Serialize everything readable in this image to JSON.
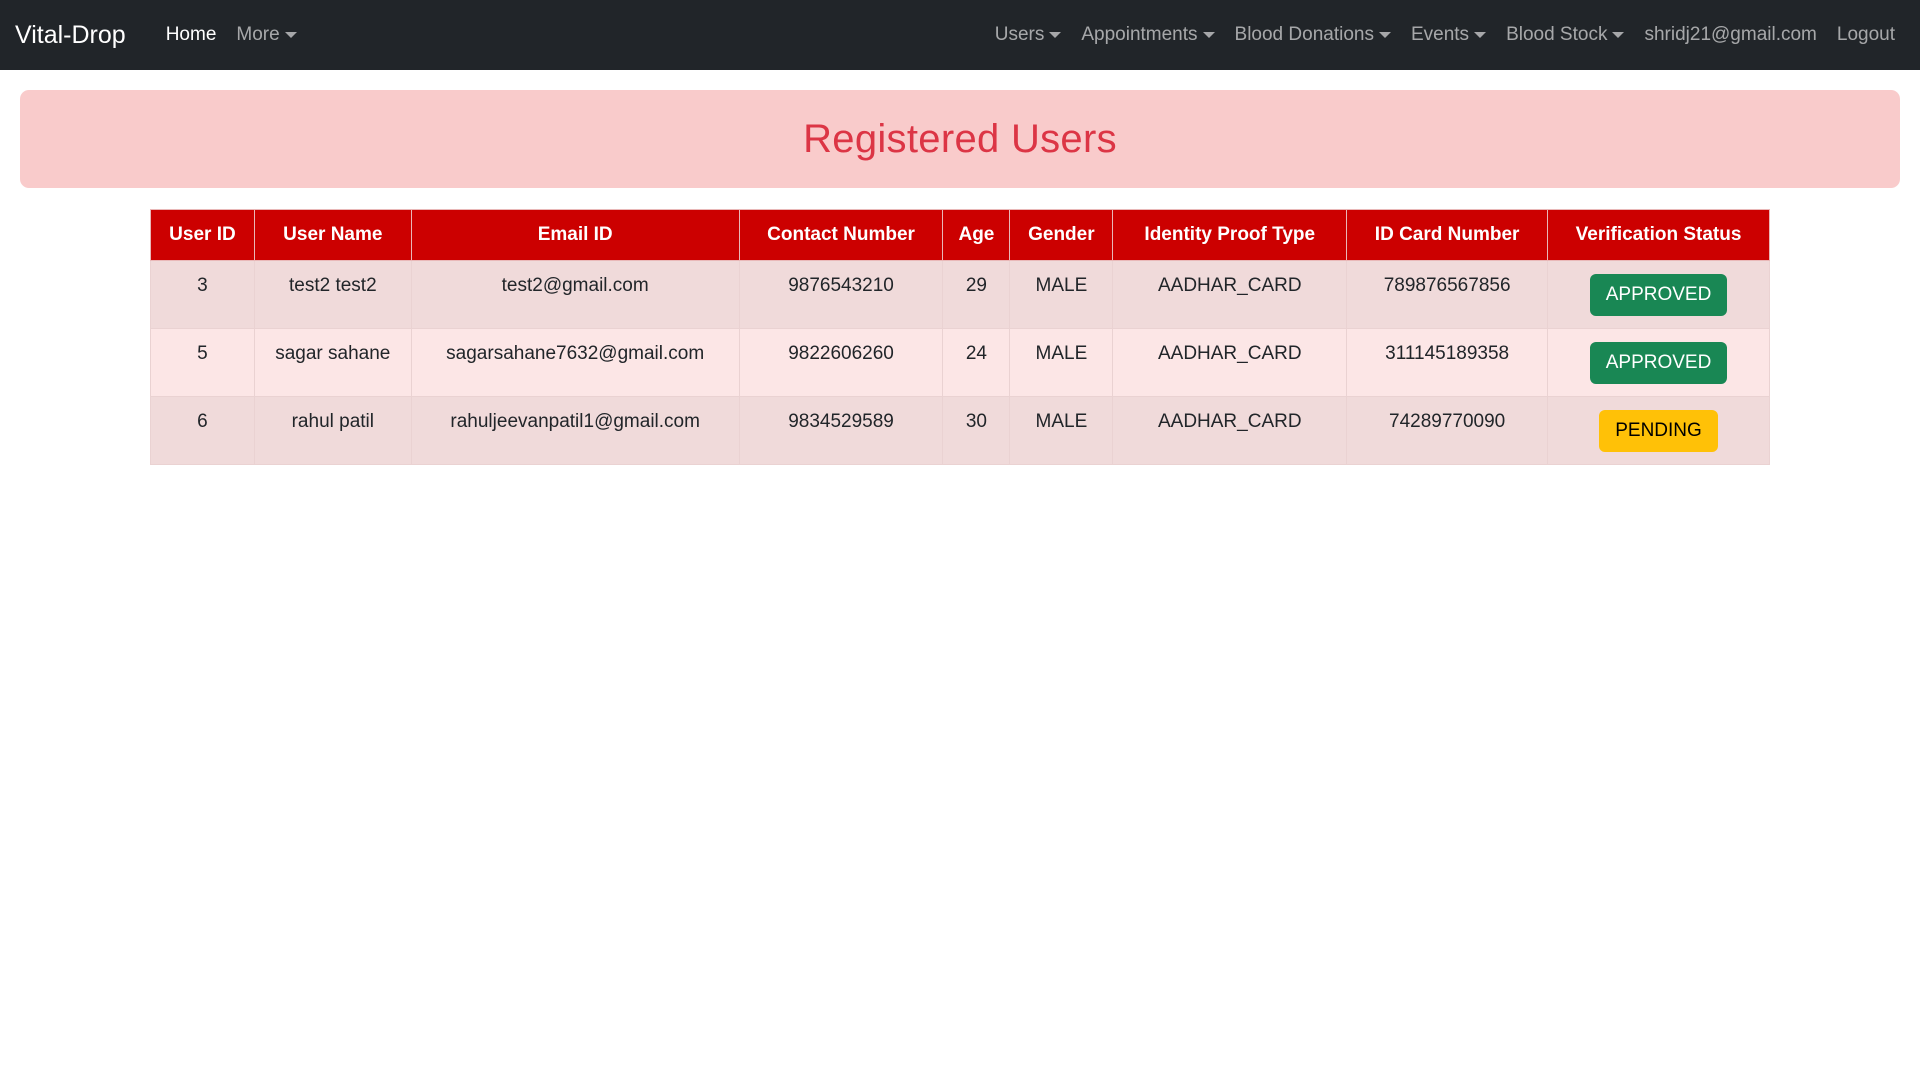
{
  "navbar": {
    "brand": "Vital-Drop",
    "left": [
      {
        "label": "Home",
        "active": true,
        "dropdown": false
      },
      {
        "label": "More",
        "active": false,
        "dropdown": true
      }
    ],
    "right": [
      {
        "label": "Users",
        "dropdown": true
      },
      {
        "label": "Appointments",
        "dropdown": true
      },
      {
        "label": "Blood Donations",
        "dropdown": true
      },
      {
        "label": "Events",
        "dropdown": true
      },
      {
        "label": "Blood Stock",
        "dropdown": true
      },
      {
        "label": "shridj21@gmail.com",
        "dropdown": false
      },
      {
        "label": "Logout",
        "dropdown": false
      }
    ]
  },
  "page": {
    "title": "Registered Users"
  },
  "table": {
    "headers": [
      "User ID",
      "User Name",
      "Email ID",
      "Contact Number",
      "Age",
      "Gender",
      "Identity Proof Type",
      "ID Card Number",
      "Verification Status"
    ],
    "rows": [
      {
        "id": "3",
        "name": "test2 test2",
        "email": "test2@gmail.com",
        "contact": "9876543210",
        "age": "29",
        "gender": "MALE",
        "proof_type": "AADHAR_CARD",
        "id_card": "789876567856",
        "status": "APPROVED"
      },
      {
        "id": "5",
        "name": "sagar sahane",
        "email": "sagarsahane7632@gmail.com",
        "contact": "9822606260",
        "age": "24",
        "gender": "MALE",
        "proof_type": "AADHAR_CARD",
        "id_card": "311145189358",
        "status": "APPROVED"
      },
      {
        "id": "6",
        "name": "rahul patil",
        "email": "rahuljeevanpatil1@gmail.com",
        "contact": "9834529589",
        "age": "30",
        "gender": "MALE",
        "proof_type": "AADHAR_CARD",
        "id_card": "74289770090",
        "status": "PENDING"
      }
    ]
  },
  "colors": {
    "navbar_bg": "#212529",
    "banner_bg": "#f9cbcb",
    "title_color": "#dc3545",
    "header_bg": "#cc0000",
    "approved": "#198754",
    "pending": "#ffc107"
  }
}
